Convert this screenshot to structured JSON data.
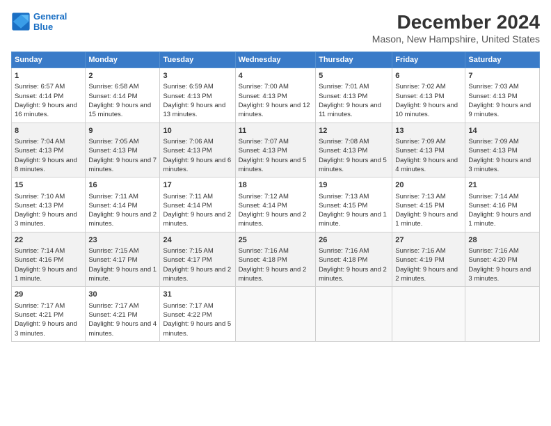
{
  "header": {
    "logo_line1": "General",
    "logo_line2": "Blue",
    "title": "December 2024",
    "subtitle": "Mason, New Hampshire, United States"
  },
  "days_of_week": [
    "Sunday",
    "Monday",
    "Tuesday",
    "Wednesday",
    "Thursday",
    "Friday",
    "Saturday"
  ],
  "weeks": [
    [
      {
        "day": "1",
        "sunrise": "Sunrise: 6:57 AM",
        "sunset": "Sunset: 4:14 PM",
        "daylight": "Daylight: 9 hours and 16 minutes."
      },
      {
        "day": "2",
        "sunrise": "Sunrise: 6:58 AM",
        "sunset": "Sunset: 4:14 PM",
        "daylight": "Daylight: 9 hours and 15 minutes."
      },
      {
        "day": "3",
        "sunrise": "Sunrise: 6:59 AM",
        "sunset": "Sunset: 4:13 PM",
        "daylight": "Daylight: 9 hours and 13 minutes."
      },
      {
        "day": "4",
        "sunrise": "Sunrise: 7:00 AM",
        "sunset": "Sunset: 4:13 PM",
        "daylight": "Daylight: 9 hours and 12 minutes."
      },
      {
        "day": "5",
        "sunrise": "Sunrise: 7:01 AM",
        "sunset": "Sunset: 4:13 PM",
        "daylight": "Daylight: 9 hours and 11 minutes."
      },
      {
        "day": "6",
        "sunrise": "Sunrise: 7:02 AM",
        "sunset": "Sunset: 4:13 PM",
        "daylight": "Daylight: 9 hours and 10 minutes."
      },
      {
        "day": "7",
        "sunrise": "Sunrise: 7:03 AM",
        "sunset": "Sunset: 4:13 PM",
        "daylight": "Daylight: 9 hours and 9 minutes."
      }
    ],
    [
      {
        "day": "8",
        "sunrise": "Sunrise: 7:04 AM",
        "sunset": "Sunset: 4:13 PM",
        "daylight": "Daylight: 9 hours and 8 minutes."
      },
      {
        "day": "9",
        "sunrise": "Sunrise: 7:05 AM",
        "sunset": "Sunset: 4:13 PM",
        "daylight": "Daylight: 9 hours and 7 minutes."
      },
      {
        "day": "10",
        "sunrise": "Sunrise: 7:06 AM",
        "sunset": "Sunset: 4:13 PM",
        "daylight": "Daylight: 9 hours and 6 minutes."
      },
      {
        "day": "11",
        "sunrise": "Sunrise: 7:07 AM",
        "sunset": "Sunset: 4:13 PM",
        "daylight": "Daylight: 9 hours and 5 minutes."
      },
      {
        "day": "12",
        "sunrise": "Sunrise: 7:08 AM",
        "sunset": "Sunset: 4:13 PM",
        "daylight": "Daylight: 9 hours and 5 minutes."
      },
      {
        "day": "13",
        "sunrise": "Sunrise: 7:09 AM",
        "sunset": "Sunset: 4:13 PM",
        "daylight": "Daylight: 9 hours and 4 minutes."
      },
      {
        "day": "14",
        "sunrise": "Sunrise: 7:09 AM",
        "sunset": "Sunset: 4:13 PM",
        "daylight": "Daylight: 9 hours and 3 minutes."
      }
    ],
    [
      {
        "day": "15",
        "sunrise": "Sunrise: 7:10 AM",
        "sunset": "Sunset: 4:13 PM",
        "daylight": "Daylight: 9 hours and 3 minutes."
      },
      {
        "day": "16",
        "sunrise": "Sunrise: 7:11 AM",
        "sunset": "Sunset: 4:14 PM",
        "daylight": "Daylight: 9 hours and 2 minutes."
      },
      {
        "day": "17",
        "sunrise": "Sunrise: 7:11 AM",
        "sunset": "Sunset: 4:14 PM",
        "daylight": "Daylight: 9 hours and 2 minutes."
      },
      {
        "day": "18",
        "sunrise": "Sunrise: 7:12 AM",
        "sunset": "Sunset: 4:14 PM",
        "daylight": "Daylight: 9 hours and 2 minutes."
      },
      {
        "day": "19",
        "sunrise": "Sunrise: 7:13 AM",
        "sunset": "Sunset: 4:15 PM",
        "daylight": "Daylight: 9 hours and 1 minute."
      },
      {
        "day": "20",
        "sunrise": "Sunrise: 7:13 AM",
        "sunset": "Sunset: 4:15 PM",
        "daylight": "Daylight: 9 hours and 1 minute."
      },
      {
        "day": "21",
        "sunrise": "Sunrise: 7:14 AM",
        "sunset": "Sunset: 4:16 PM",
        "daylight": "Daylight: 9 hours and 1 minute."
      }
    ],
    [
      {
        "day": "22",
        "sunrise": "Sunrise: 7:14 AM",
        "sunset": "Sunset: 4:16 PM",
        "daylight": "Daylight: 9 hours and 1 minute."
      },
      {
        "day": "23",
        "sunrise": "Sunrise: 7:15 AM",
        "sunset": "Sunset: 4:17 PM",
        "daylight": "Daylight: 9 hours and 1 minute."
      },
      {
        "day": "24",
        "sunrise": "Sunrise: 7:15 AM",
        "sunset": "Sunset: 4:17 PM",
        "daylight": "Daylight: 9 hours and 2 minutes."
      },
      {
        "day": "25",
        "sunrise": "Sunrise: 7:16 AM",
        "sunset": "Sunset: 4:18 PM",
        "daylight": "Daylight: 9 hours and 2 minutes."
      },
      {
        "day": "26",
        "sunrise": "Sunrise: 7:16 AM",
        "sunset": "Sunset: 4:18 PM",
        "daylight": "Daylight: 9 hours and 2 minutes."
      },
      {
        "day": "27",
        "sunrise": "Sunrise: 7:16 AM",
        "sunset": "Sunset: 4:19 PM",
        "daylight": "Daylight: 9 hours and 2 minutes."
      },
      {
        "day": "28",
        "sunrise": "Sunrise: 7:16 AM",
        "sunset": "Sunset: 4:20 PM",
        "daylight": "Daylight: 9 hours and 3 minutes."
      }
    ],
    [
      {
        "day": "29",
        "sunrise": "Sunrise: 7:17 AM",
        "sunset": "Sunset: 4:21 PM",
        "daylight": "Daylight: 9 hours and 3 minutes."
      },
      {
        "day": "30",
        "sunrise": "Sunrise: 7:17 AM",
        "sunset": "Sunset: 4:21 PM",
        "daylight": "Daylight: 9 hours and 4 minutes."
      },
      {
        "day": "31",
        "sunrise": "Sunrise: 7:17 AM",
        "sunset": "Sunset: 4:22 PM",
        "daylight": "Daylight: 9 hours and 5 minutes."
      },
      null,
      null,
      null,
      null
    ]
  ]
}
